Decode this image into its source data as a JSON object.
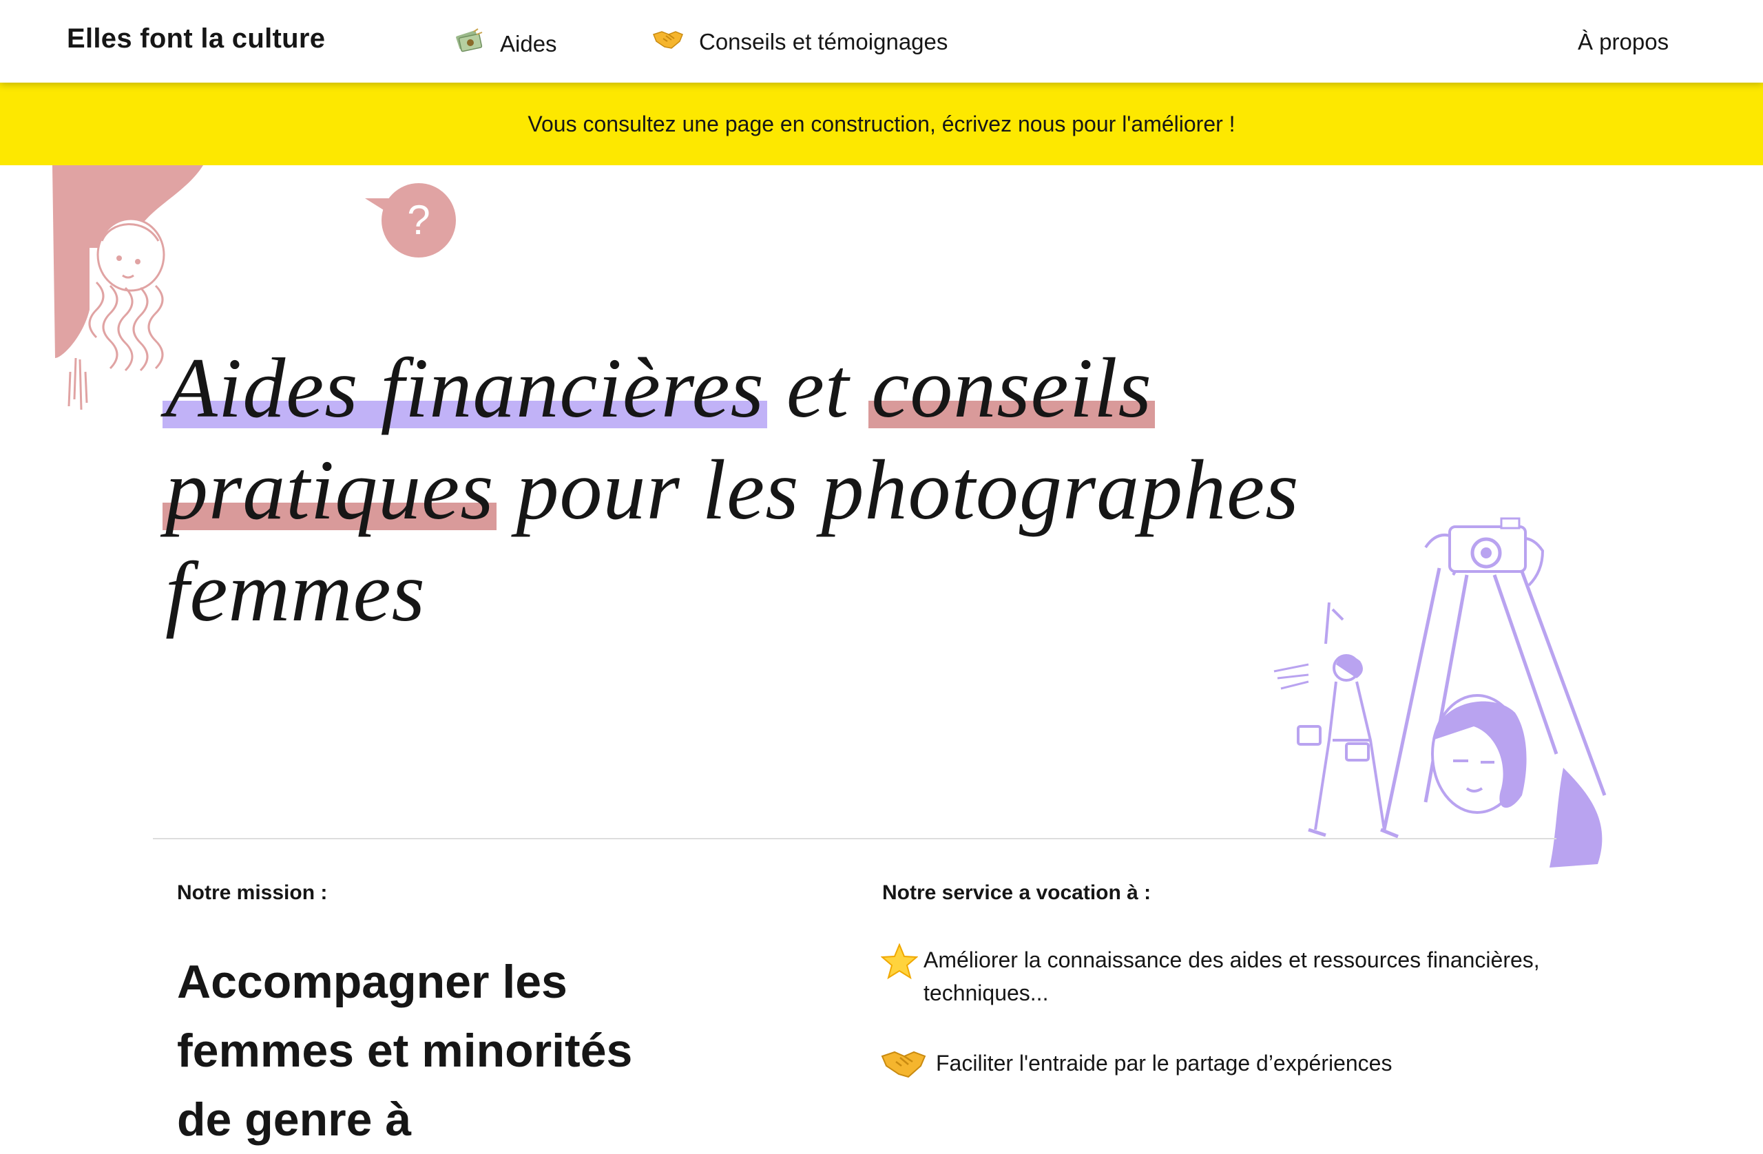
{
  "header": {
    "brand": "Elles font la culture",
    "nav": [
      {
        "label": "Aides",
        "icon": "money-bills-icon"
      },
      {
        "label": "Conseils et témoignages",
        "icon": "handshake-icon"
      }
    ],
    "about": "À propos"
  },
  "notice": {
    "text": "Vous consultez une page en construction, écrivez nous pour l'améliorer !"
  },
  "hero": {
    "title_parts": [
      "Aides financières",
      "et",
      "conseils",
      "pratiques",
      "pour les photographes femmes"
    ]
  },
  "mission": {
    "label": "Notre mission :",
    "title": "Accompagner les femmes et minorités de genre à"
  },
  "service": {
    "label": "Notre service a vocation à :",
    "goals": [
      {
        "icon": "star-icon",
        "text": "Améliorer la connaissance des aides et ressources financières, techniques..."
      },
      {
        "icon": "handshake-icon",
        "text": "Faciliter l'entraide par le partage d’expériences"
      }
    ]
  },
  "colors": {
    "notice_bg": "#fde800",
    "highlight_purple": "#c1b2f7",
    "highlight_pink": "#d99a9a",
    "illustration_pink": "#e0a3a3",
    "illustration_purple": "#b9a3f0"
  }
}
